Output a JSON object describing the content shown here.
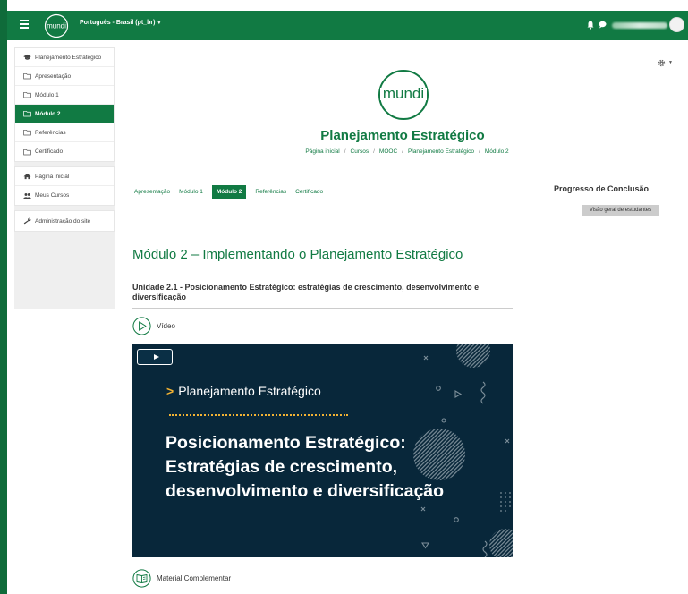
{
  "topbar": {
    "language": "Português - Brasil (pt_br)",
    "logo_text": "mundi"
  },
  "sidebar": {
    "groups": [
      [
        {
          "label": "Planejamento Estratégico",
          "icon": "graduation-cap-icon"
        },
        {
          "label": "Apresentação",
          "icon": "folder-icon"
        },
        {
          "label": "Módulo 1",
          "icon": "folder-icon"
        },
        {
          "label": "Módulo 2",
          "icon": "folder-icon",
          "active": true
        },
        {
          "label": "Referências",
          "icon": "folder-icon"
        },
        {
          "label": "Certificado",
          "icon": "folder-icon"
        }
      ],
      [
        {
          "label": "Página inicial",
          "icon": "home-icon"
        },
        {
          "label": "Meus Cursos",
          "icon": "users-icon"
        }
      ],
      [
        {
          "label": "Administração do site",
          "icon": "wrench-icon"
        }
      ]
    ]
  },
  "header": {
    "logo_text": "mundi",
    "course_title": "Planejamento Estratégico",
    "breadcrumb": [
      "Página inicial",
      "Cursos",
      "MOOC",
      "Planejamento Estratégico",
      "Módulo 2"
    ]
  },
  "tabs": [
    {
      "label": "Apresentação"
    },
    {
      "label": "Módulo 1"
    },
    {
      "label": "Módulo 2",
      "active": true
    },
    {
      "label": "Referências"
    },
    {
      "label": "Certificado"
    }
  ],
  "progress": {
    "title": "Progresso de Conclusão",
    "button": "Visão geral de estudantes"
  },
  "main": {
    "module_title": "Módulo 2 – Implementando o Planejamento Estratégico",
    "unit_title": "Unidade 2.1 - Posicionamento Estratégico: estratégias de crescimento, desenvolvimento e diversificação",
    "activities": {
      "video": "Vídeo",
      "material": "Material Complementar"
    }
  },
  "video": {
    "subtitle": "Planejamento Estratégico",
    "title_lines": [
      "Posicionamento Estratégico:",
      "Estratégias de crescimento,",
      "desenvolvimento e diversificação"
    ]
  },
  "colors": {
    "brand": "#117a43",
    "video_bg": "#08273a",
    "accent": "#f2b233"
  }
}
